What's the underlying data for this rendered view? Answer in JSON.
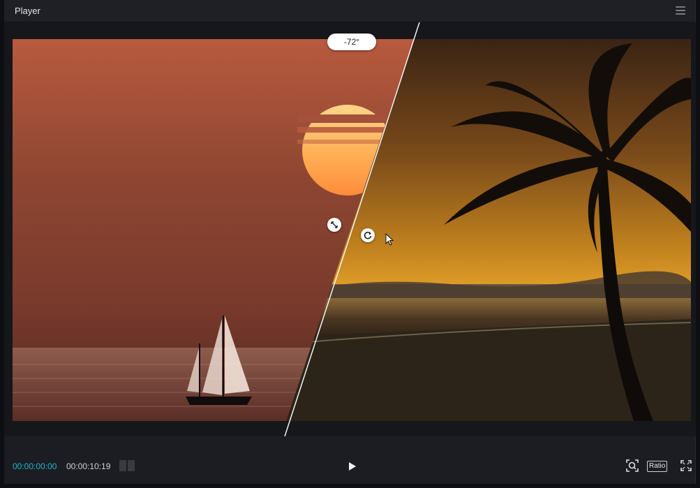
{
  "panel": {
    "title": "Player"
  },
  "preview": {
    "angle_label": "-72°",
    "left_clip": "sailboat at sunset",
    "right_clip": "palm tree beach sunset"
  },
  "controls": {
    "current_time": "00:00:00:00",
    "total_time": "00:00:10:19",
    "ratio_label": "Ratio"
  },
  "colors": {
    "accent_timecode": "#1fb5c9",
    "panel_bg": "#1c1d22"
  }
}
